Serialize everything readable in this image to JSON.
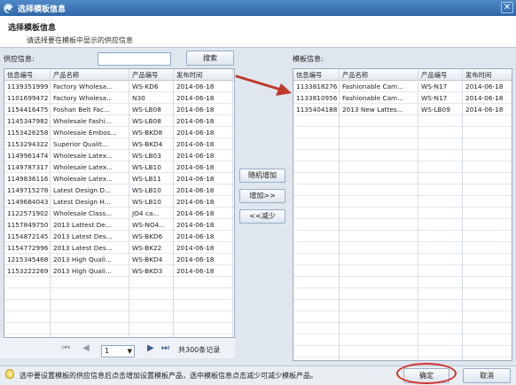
{
  "window": {
    "title": "选择模板信息",
    "close_glyph": "✕"
  },
  "header": {
    "title": "选择模板信息",
    "subtitle": "请选择要在模板中显示的供应信息"
  },
  "supply": {
    "label": "供应信息:",
    "search_value": "",
    "search_button": "搜索",
    "columns": [
      "信息编号",
      "产品名称",
      "产品编号",
      "发布时间"
    ],
    "rows": [
      [
        "1139351999",
        "Factory Wholesa...",
        "WS-KD6",
        "2014-06-18"
      ],
      [
        "1101699472",
        "Factory Wholesa...",
        "N30",
        "2014-06-18"
      ],
      [
        "1154416475",
        "Foshan Belt Fac...",
        "WS-LB08",
        "2014-06-18"
      ],
      [
        "1145347982",
        "Wholesale Fashi...",
        "WS-LB08",
        "2014-06-18"
      ],
      [
        "1153426258",
        "Wholesale Embos...",
        "WS-BKD8",
        "2014-06-18"
      ],
      [
        "1153294322",
        "Superior Qualit...",
        "WS-BKD4",
        "2014-06-18"
      ],
      [
        "1149961474",
        "Wholesale Latex...",
        "WS-LB03",
        "2014-06-18"
      ],
      [
        "1149787317",
        "Wholesale Latex...",
        "WS-LB10",
        "2014-06-18"
      ],
      [
        "1149836116",
        "Wholesale Latex...",
        "WS-LB11",
        "2014-06-18"
      ],
      [
        "1149715278",
        "Latest Design D...",
        "WS-LB10",
        "2014-06-18"
      ],
      [
        "1149684043",
        "Latest Design H...",
        "WS-LB10",
        "2014-06-18"
      ],
      [
        "1122571902",
        "Wholesale Class...",
        "JO4 ca...",
        "2014-06-18"
      ],
      [
        "1157849750",
        "2013 Lattest De...",
        "WS-NO4...",
        "2014-06-18"
      ],
      [
        "1154872145",
        "2013 Latest Des...",
        "WS-BKD6",
        "2014-06-18"
      ],
      [
        "1154772996",
        "2013 Latest Des...",
        "WS-BK22",
        "2014-06-18"
      ],
      [
        "1215345468",
        "2013 High Quali...",
        "WS-BKD4",
        "2014-06-18"
      ],
      [
        "1153222269",
        "2013 High Quali...",
        "WS-BKD3",
        "2014-06-18"
      ]
    ]
  },
  "pager": {
    "first": "⏮",
    "prev": "◀",
    "page": "1",
    "next": "▶",
    "last": "⏭",
    "total": "共300条记录"
  },
  "actions": {
    "random_add": "随机增加",
    "add": "增加>>",
    "remove": "<<减少"
  },
  "template": {
    "label": "模板信息:",
    "columns": [
      "信息编号",
      "产品名称",
      "产品编号",
      "发布时间"
    ],
    "rows": [
      [
        "1133818276",
        "Fashionable Cam...",
        "WS-N17",
        "2014-06-18"
      ],
      [
        "1133810956",
        "Fashionable Cam...",
        "WS-N17",
        "2014-06-18"
      ],
      [
        "1135404188",
        "2013 New Lattes...",
        "WS-LB09",
        "2014-06-18"
      ]
    ]
  },
  "footer": {
    "hint": "选中要设置模板的供应信息后点击增加设置模板产品，选中模板信息点击减少可减少模板产品。",
    "ok": "确定",
    "cancel": "取消"
  },
  "colors": {
    "accent": "#2f66a8",
    "highlight_ring": "#d0312d",
    "annotation_arrow": "#c0392b"
  }
}
